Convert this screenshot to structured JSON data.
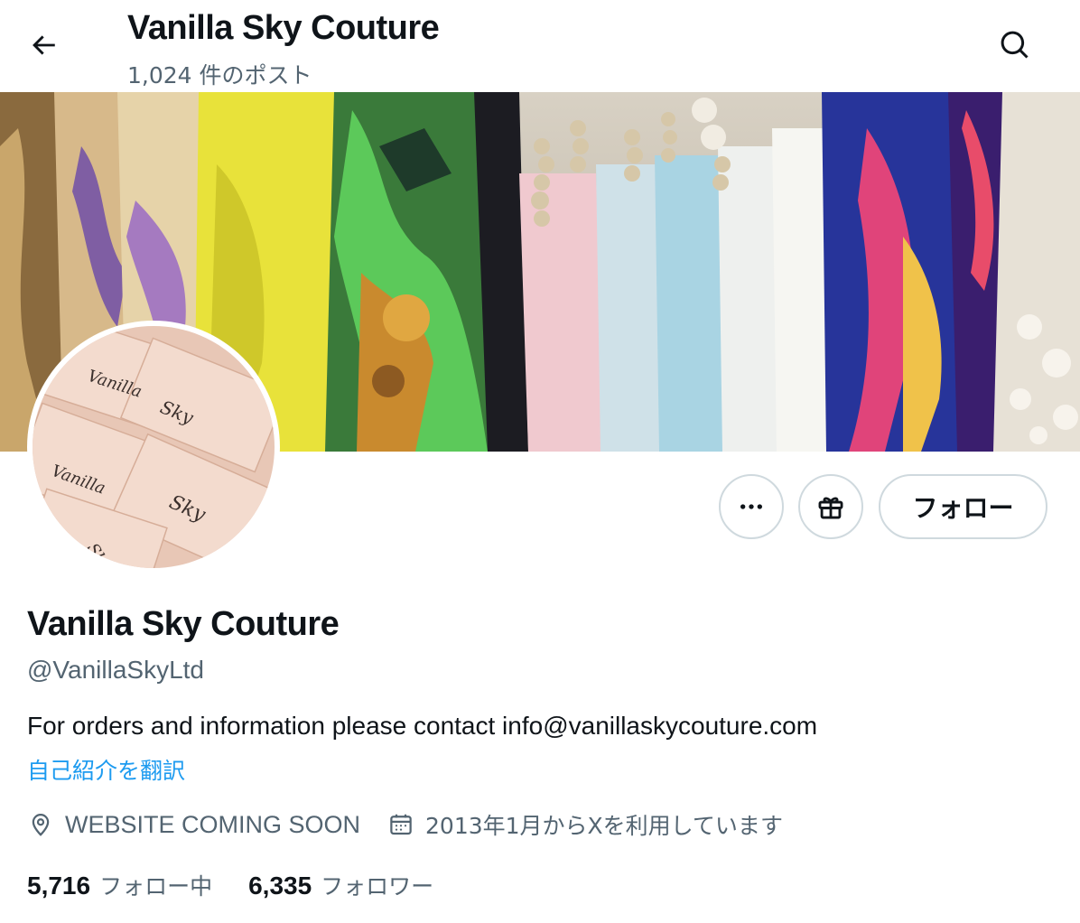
{
  "header": {
    "title": "Vanilla Sky Couture",
    "post_count": "1,024 件のポスト",
    "back_icon": "arrow-left-icon",
    "search_icon": "search-icon"
  },
  "profile": {
    "display_name": "Vanilla Sky Couture",
    "handle": "@VanillaSkyLtd",
    "bio": "For orders and information please contact info@vanillaskycouture.com",
    "translate_label": "自己紹介を翻訳",
    "location": "WEBSITE COMING SOON",
    "joined": "2013年1月からXを利用しています",
    "avatar_text": "Vanilla Sky"
  },
  "actions": {
    "more_icon": "more-horizontal-icon",
    "gift_icon": "gift-icon",
    "follow_label": "フォロー"
  },
  "stats": {
    "following_count": "5,716",
    "following_label": "フォロー中",
    "followers_count": "6,335",
    "followers_label": "フォロワー"
  },
  "colors": {
    "text_primary": "#0f1419",
    "text_secondary": "#536471",
    "link": "#1d9bf0",
    "border": "#cfd9de"
  }
}
